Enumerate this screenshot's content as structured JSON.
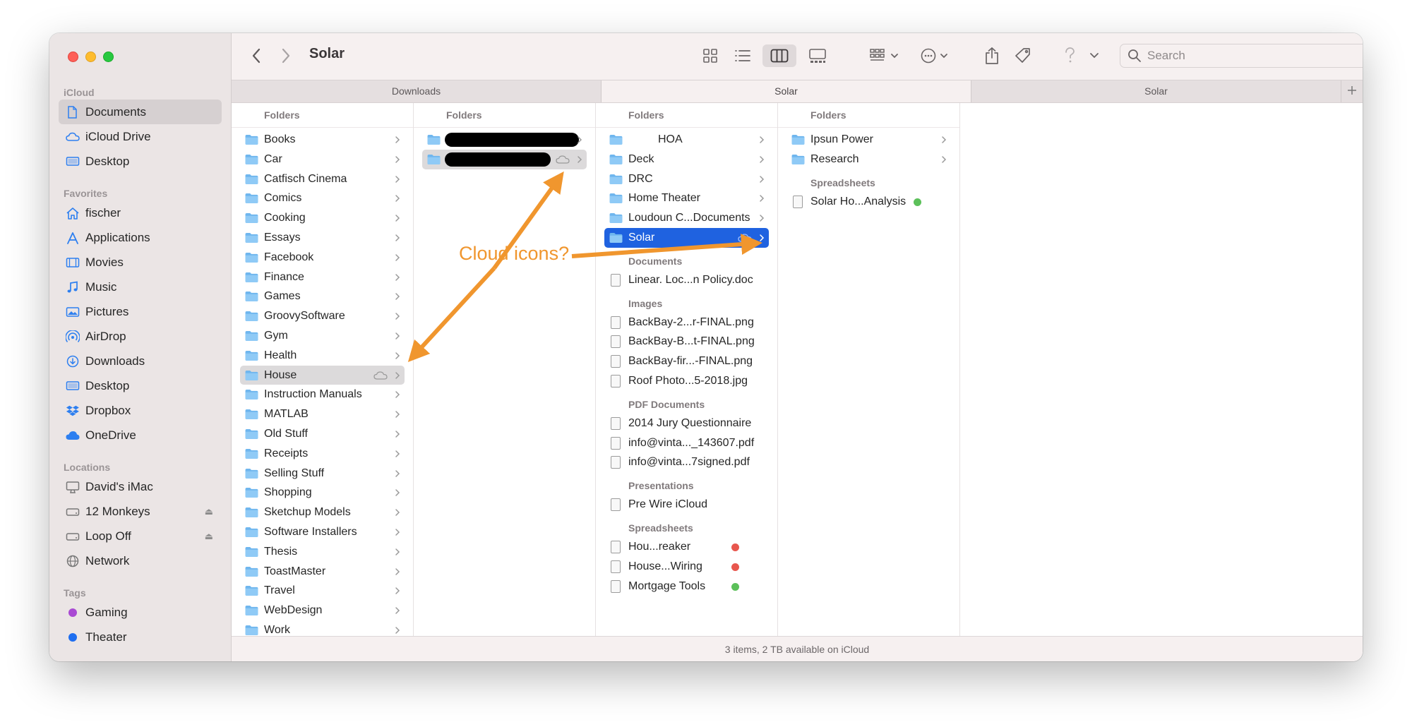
{
  "window": {
    "title": "Solar"
  },
  "sidebar": {
    "sections": [
      {
        "label": "iCloud",
        "items": [
          {
            "label": "Documents",
            "icon": "document-icon",
            "selected": true
          },
          {
            "label": "iCloud Drive",
            "icon": "cloud-icon"
          },
          {
            "label": "Desktop",
            "icon": "desktop-icon"
          }
        ]
      },
      {
        "label": "Favorites",
        "items": [
          {
            "label": "fischer",
            "icon": "house-icon"
          },
          {
            "label": "Applications",
            "icon": "applications-icon"
          },
          {
            "label": "Movies",
            "icon": "film-icon"
          },
          {
            "label": "Music",
            "icon": "music-note-icon"
          },
          {
            "label": "Pictures",
            "icon": "photo-icon"
          },
          {
            "label": "AirDrop",
            "icon": "airdrop-icon"
          },
          {
            "label": "Downloads",
            "icon": "download-icon"
          },
          {
            "label": "Desktop",
            "icon": "desktop-icon"
          },
          {
            "label": "Dropbox",
            "icon": "dropbox-icon"
          },
          {
            "label": "OneDrive",
            "icon": "onedrive-cloud-icon"
          }
        ]
      },
      {
        "label": "Locations",
        "items": [
          {
            "label": "David's iMac",
            "icon": "imac-icon"
          },
          {
            "label": "12 Monkeys",
            "icon": "disk-icon",
            "eject": true
          },
          {
            "label": "Loop Off",
            "icon": "disk-icon",
            "eject": true
          },
          {
            "label": "Network",
            "icon": "globe-icon"
          }
        ]
      },
      {
        "label": "Tags",
        "items": [
          {
            "label": "Gaming",
            "tag_color": "#a94ad3"
          },
          {
            "label": "Theater",
            "tag_color": "#1e6ef0"
          }
        ]
      }
    ]
  },
  "toolbar": {
    "back_icon": "chevron-left-icon",
    "forward_icon": "chevron-right-icon",
    "search_placeholder": "Search"
  },
  "tabs": [
    {
      "label": "Downloads",
      "active": false
    },
    {
      "label": "Solar",
      "active": true
    },
    {
      "label": "Solar",
      "active": false
    }
  ],
  "columns": [
    {
      "header": "Folders",
      "sections": [
        {
          "items": [
            {
              "name": "Books",
              "type": "folder"
            },
            {
              "name": "Car",
              "type": "folder"
            },
            {
              "name": "Catfisch Cinema",
              "type": "folder"
            },
            {
              "name": "Comics",
              "type": "folder"
            },
            {
              "name": "Cooking",
              "type": "folder"
            },
            {
              "name": "Essays",
              "type": "folder"
            },
            {
              "name": "Facebook",
              "type": "folder"
            },
            {
              "name": "Finance",
              "type": "folder"
            },
            {
              "name": "Games",
              "type": "folder"
            },
            {
              "name": "GroovySoftware",
              "type": "folder"
            },
            {
              "name": "Gym",
              "type": "folder"
            },
            {
              "name": "Health",
              "type": "folder"
            },
            {
              "name": "House",
              "type": "folder",
              "selected": "gray",
              "cloud": true
            },
            {
              "name": "Instruction Manuals",
              "type": "folder"
            },
            {
              "name": "MATLAB",
              "type": "folder"
            },
            {
              "name": "Old Stuff",
              "type": "folder"
            },
            {
              "name": "Receipts",
              "type": "folder"
            },
            {
              "name": "Selling Stuff",
              "type": "folder"
            },
            {
              "name": "Shopping",
              "type": "folder"
            },
            {
              "name": "Sketchup Models",
              "type": "folder"
            },
            {
              "name": "Software Installers",
              "type": "folder"
            },
            {
              "name": "Thesis",
              "type": "folder"
            },
            {
              "name": "ToastMaster",
              "type": "folder"
            },
            {
              "name": "Travel",
              "type": "folder"
            },
            {
              "name": "WebDesign",
              "type": "folder"
            },
            {
              "name": "Work",
              "type": "folder"
            }
          ]
        }
      ]
    },
    {
      "header": "Folders",
      "sections": [
        {
          "items": [
            {
              "name": "",
              "type": "folder",
              "redacted": true,
              "chevron": true
            },
            {
              "name": "",
              "type": "folder",
              "redacted": true,
              "selected": "gray",
              "cloud": true,
              "chevron": true
            }
          ]
        }
      ]
    },
    {
      "header": "Folders",
      "sections": [
        {
          "items": [
            {
              "name": "HOA",
              "type": "folder",
              "chevron": true
            },
            {
              "name": "Deck",
              "type": "folder",
              "chevron": true
            },
            {
              "name": "DRC",
              "type": "folder",
              "chevron": true
            },
            {
              "name": "Home Theater",
              "type": "folder",
              "chevron": true
            },
            {
              "name": "Loudoun C...Documents",
              "type": "folder",
              "chevron": true
            },
            {
              "name": "Solar",
              "type": "folder",
              "selected": "blue",
              "cloud": true,
              "chevron": true
            }
          ]
        },
        {
          "label": "Documents",
          "items": [
            {
              "name": "Linear. Loc...n Policy.doc",
              "type": "file"
            }
          ]
        },
        {
          "label": "Images",
          "items": [
            {
              "name": "BackBay-2...r-FINAL.png",
              "type": "file"
            },
            {
              "name": "BackBay-B...t-FINAL.png",
              "type": "file"
            },
            {
              "name": "BackBay-fir...-FINAL.png",
              "type": "file"
            },
            {
              "name": "Roof Photo...5-2018.jpg",
              "type": "file"
            }
          ]
        },
        {
          "label": "PDF Documents",
          "items": [
            {
              "name": "2014 Jury Questionnaire",
              "type": "file"
            },
            {
              "name": "info@vinta..._143607.pdf",
              "type": "file"
            },
            {
              "name": "info@vinta...7signed.pdf",
              "type": "file"
            }
          ]
        },
        {
          "label": "Presentations",
          "items": [
            {
              "name": "Pre Wire iCloud",
              "type": "file"
            }
          ]
        },
        {
          "label": "Spreadsheets",
          "items": [
            {
              "name": "Hou...reaker",
              "type": "file",
              "dot": "#e8574e"
            },
            {
              "name": "House...Wiring",
              "type": "file",
              "dot": "#e8574e"
            },
            {
              "name": "Mortgage Tools",
              "type": "file",
              "dot": "#5cc05a"
            }
          ]
        }
      ]
    },
    {
      "header": "Folders",
      "sections": [
        {
          "items": [
            {
              "name": "Ipsun Power",
              "type": "folder",
              "chevron": true
            },
            {
              "name": "Research",
              "type": "folder",
              "chevron": true
            }
          ]
        },
        {
          "label": "Spreadsheets",
          "items": [
            {
              "name": "Solar Ho...Analysis",
              "type": "file",
              "dot": "#5cc05a"
            }
          ]
        }
      ]
    }
  ],
  "status": {
    "text": "3 items, 2 TB available on iCloud"
  },
  "annotation": {
    "label": "Cloud icons?",
    "color": "#f0962e"
  }
}
